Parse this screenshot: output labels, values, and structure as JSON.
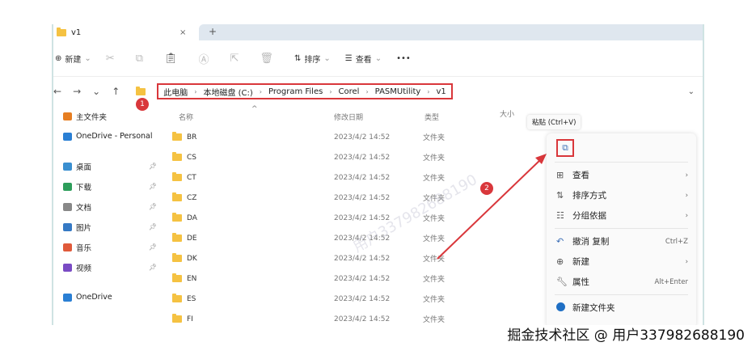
{
  "tab": {
    "title": "v1",
    "close": "×",
    "new": "+"
  },
  "toolbar": {
    "new": "新建",
    "sort": "排序",
    "view": "查看",
    "more": "•••"
  },
  "breadcrumb": [
    "此电脑",
    "本地磁盘 (C:)",
    "Program Files",
    "Corel",
    "PASMUtility",
    "v1"
  ],
  "sidebar": [
    {
      "label": "主文件夹",
      "color": "#e67e22"
    },
    {
      "label": "OneDrive - Personal",
      "color": "#2a7fd4"
    },
    {
      "label": "桌面",
      "color": "#3a8fd0",
      "pin": true
    },
    {
      "label": "下载",
      "color": "#2d9d5a",
      "pin": true
    },
    {
      "label": "文档",
      "color": "#888",
      "pin": true
    },
    {
      "label": "图片",
      "color": "#3579c4",
      "pin": true
    },
    {
      "label": "音乐",
      "color": "#e05a3a",
      "pin": true
    },
    {
      "label": "视频",
      "color": "#7a4bc4",
      "pin": true
    },
    {
      "label": "OneDrive",
      "color": "#2a7fd4"
    }
  ],
  "columns": {
    "name": "名称",
    "date": "修改日期",
    "type": "类型",
    "size": "大小"
  },
  "files": [
    {
      "name": "BR",
      "date": "2023/4/2 14:52",
      "type": "文件夹"
    },
    {
      "name": "CS",
      "date": "2023/4/2 14:52",
      "type": "文件夹"
    },
    {
      "name": "CT",
      "date": "2023/4/2 14:52",
      "type": "文件夹"
    },
    {
      "name": "CZ",
      "date": "2023/4/2 14:52",
      "type": "文件夹"
    },
    {
      "name": "DA",
      "date": "2023/4/2 14:52",
      "type": "文件夹"
    },
    {
      "name": "DE",
      "date": "2023/4/2 14:52",
      "type": "文件夹"
    },
    {
      "name": "DK",
      "date": "2023/4/2 14:52",
      "type": "文件夹"
    },
    {
      "name": "EN",
      "date": "2023/4/2 14:52",
      "type": "文件夹"
    },
    {
      "name": "ES",
      "date": "2023/4/2 14:52",
      "type": "文件夹"
    },
    {
      "name": "FI",
      "date": "2023/4/2 14:52",
      "type": "文件夹"
    }
  ],
  "tooltip": "粘贴 (Ctrl+V)",
  "menu": {
    "view": "查看",
    "sort": "排序方式",
    "group": "分组依据",
    "undo": "撤消 复制",
    "undo_key": "Ctrl+Z",
    "new": "新建",
    "props": "属性",
    "props_key": "Alt+Enter",
    "new_folder": "新建文件夹"
  },
  "badges": [
    "1",
    "2"
  ],
  "watermark": "掘金技术社区 @ 用户337982688190",
  "faint_watermark": "用户337982688190"
}
